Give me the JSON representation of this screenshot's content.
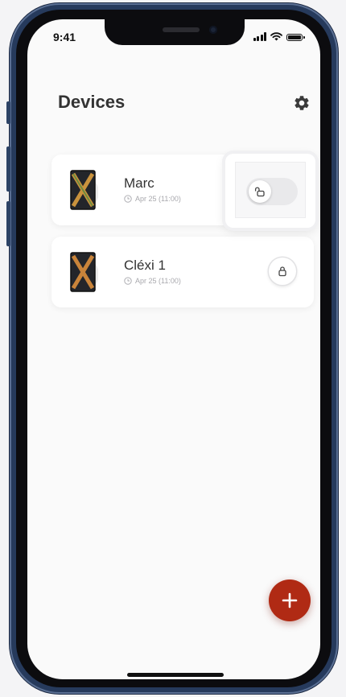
{
  "status_bar": {
    "time": "9:41"
  },
  "header": {
    "title": "Devices"
  },
  "devices": [
    {
      "name": "Marc",
      "last_seen": "Apr 25 (11:00)",
      "lock_state": "unlocked"
    },
    {
      "name": "Cléxi 1",
      "last_seen": "Apr 25 (11:00)",
      "lock_state": "locked"
    }
  ],
  "colors": {
    "accent": "#b02a14",
    "phone_frame": "#263a5c",
    "title_text": "#333333",
    "meta_text": "#a8a8ad"
  },
  "icons": [
    "settings-gear-icon",
    "clock-icon",
    "unlock-icon",
    "lock-icon",
    "plus-icon",
    "signal-icon",
    "wifi-icon",
    "battery-icon"
  ]
}
